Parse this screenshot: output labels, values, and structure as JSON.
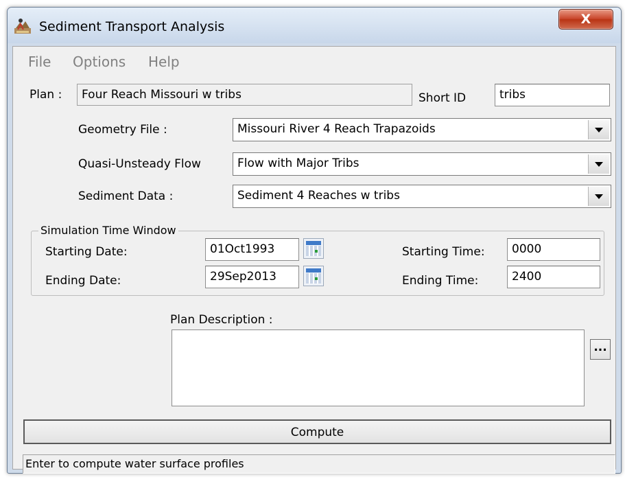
{
  "window": {
    "title": "Sediment Transport Analysis",
    "close_glyph": "X",
    "app_icon": "sediment-app-icon"
  },
  "menu": [
    "File",
    "Options",
    "Help"
  ],
  "plan": {
    "label": "Plan :",
    "value": "Four Reach Missouri w tribs",
    "short_id_label": "Short ID",
    "short_id_value": "tribs"
  },
  "geometry": {
    "label": "Geometry File :",
    "value": "Missouri River 4 Reach Trapazoids"
  },
  "flow": {
    "label": "Quasi-Unsteady Flow",
    "value": "Flow with Major Tribs"
  },
  "sediment": {
    "label": "Sediment Data :",
    "value": "Sediment 4 Reaches w tribs"
  },
  "sim": {
    "legend": "Simulation Time Window",
    "start_date_label": "Starting Date:",
    "start_date": "01Oct1993",
    "end_date_label": "Ending Date:",
    "end_date": "29Sep2013",
    "start_time_label": "Starting Time:",
    "start_time": "0000",
    "end_time_label": "Ending Time:",
    "end_time": "2400"
  },
  "description": {
    "label": "Plan Description :",
    "value": "",
    "more_button": "..."
  },
  "compute_label": "Compute",
  "status": "Enter to compute water surface profiles",
  "colors": {
    "title_bg": "#cfdbea",
    "close_red": "#c9462b",
    "client_bg": "#f0f0f0"
  }
}
